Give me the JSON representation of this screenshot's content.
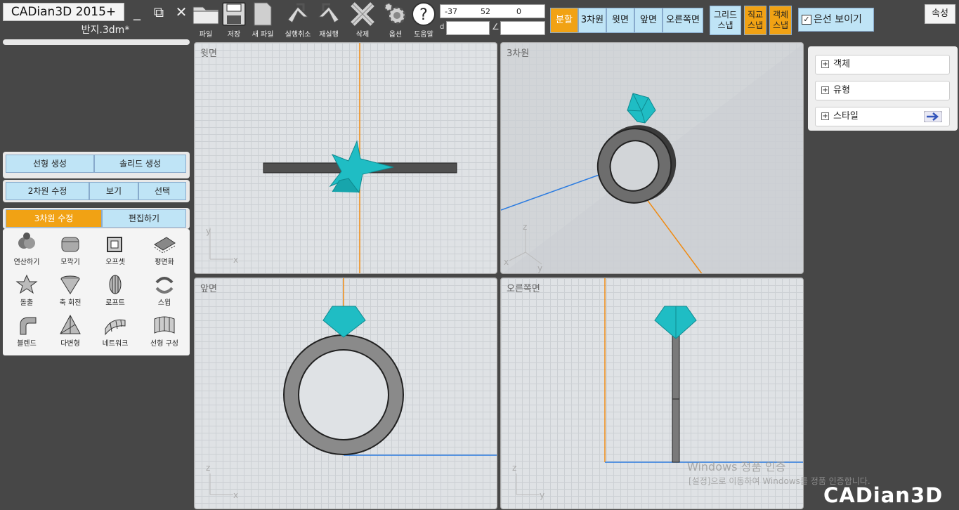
{
  "app": {
    "title": "CADian3D 2015+",
    "file_name": "반지.3dm*",
    "brand": "CADian3D"
  },
  "window": {
    "minimize": "_",
    "restore": "⧉",
    "close": "✕"
  },
  "toolbar": [
    {
      "label": "파일",
      "icon": "folder-icon"
    },
    {
      "label": "저장",
      "icon": "save-icon"
    },
    {
      "label": "새 파일",
      "icon": "new-file-icon"
    },
    {
      "label": "실행취소",
      "icon": "undo-icon"
    },
    {
      "label": "재실행",
      "icon": "redo-icon"
    },
    {
      "label": "삭제",
      "icon": "delete-icon"
    },
    {
      "label": "옵션",
      "icon": "gear-icon"
    },
    {
      "label": "도움말",
      "icon": "help-icon"
    }
  ],
  "coords": {
    "x": "-37",
    "y": "52",
    "z": "0",
    "distance_label": "d",
    "distance_value": "",
    "angle_label": "∠",
    "angle_value": ""
  },
  "views": [
    {
      "label": "분할",
      "active": true
    },
    {
      "label": "3차원",
      "active": false
    },
    {
      "label": "윗면",
      "active": false
    },
    {
      "label": "앞면",
      "active": false
    },
    {
      "label": "오른쪽면",
      "active": false
    }
  ],
  "snaps": [
    {
      "line1": "그리드",
      "line2": "스냅",
      "on": false
    },
    {
      "line1": "직교",
      "line2": "스냅",
      "on": true
    },
    {
      "line1": "객체",
      "line2": "스냅",
      "on": true
    }
  ],
  "hidden_line": {
    "label": "은선 보이기",
    "checked": true
  },
  "properties_button": "속성",
  "left_tabs": {
    "row1": [
      "선형 생성",
      "솔리드 생성"
    ],
    "row2": [
      "2차원 수정",
      "보기",
      "선택"
    ],
    "row3": {
      "active": "3차원 수정",
      "other": "편집하기"
    }
  },
  "tools": [
    {
      "label": "연산하기",
      "icon": "boolean-icon"
    },
    {
      "label": "모깍기",
      "icon": "fillet-icon"
    },
    {
      "label": "오프셋",
      "icon": "offset-icon"
    },
    {
      "label": "평면화",
      "icon": "flatten-icon"
    },
    {
      "label": "돌출",
      "icon": "extrude-icon"
    },
    {
      "label": "축 회전",
      "icon": "revolve-icon"
    },
    {
      "label": "로프트",
      "icon": "loft-icon"
    },
    {
      "label": "스윕",
      "icon": "sweep-icon"
    },
    {
      "label": "블렌드",
      "icon": "blend-icon"
    },
    {
      "label": "다변형",
      "icon": "polygon-icon"
    },
    {
      "label": "네트워크",
      "icon": "network-icon"
    },
    {
      "label": "선형 구성",
      "icon": "curve-construct-icon"
    }
  ],
  "viewports": {
    "top": {
      "title": "윗면",
      "axis_a": "y",
      "axis_b": "x"
    },
    "perspective": {
      "title": "3차원",
      "axis_a": "z",
      "axis_b": "x",
      "axis_c": "y"
    },
    "front": {
      "title": "앞면",
      "axis_a": "z",
      "axis_b": "x"
    },
    "right": {
      "title": "오른쪽면",
      "axis_a": "z",
      "axis_b": "y"
    }
  },
  "side_panel": [
    {
      "label": "객체"
    },
    {
      "label": "유형"
    },
    {
      "label": "스타일"
    }
  ],
  "watermark": {
    "line1": "Windows 정품 인증",
    "line2": "[설정]으로 이동하여 Windows를 정품 인증합니다."
  },
  "colors": {
    "accent_orange": "#f1a214",
    "tab_blue": "#bfe4f6",
    "gem_teal": "#1fbdc4",
    "axis_orange": "#f08a10",
    "axis_blue": "#2a7be0"
  }
}
